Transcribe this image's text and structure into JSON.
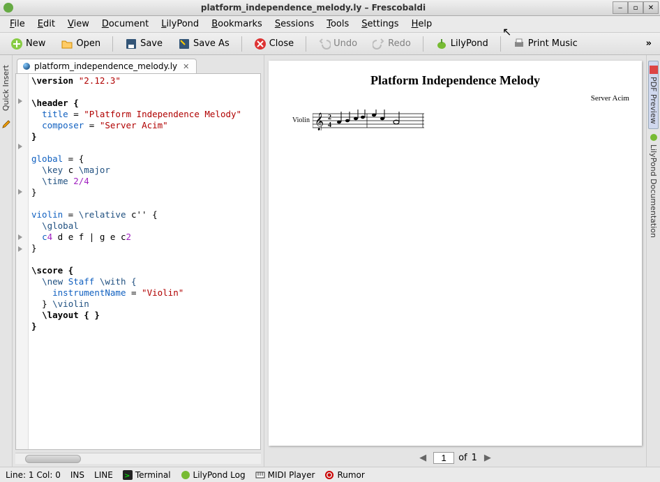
{
  "window": {
    "title": "platform_independence_melody.ly – Frescobaldi"
  },
  "menubar": [
    "File",
    "Edit",
    "View",
    "Document",
    "LilyPond",
    "Bookmarks",
    "Sessions",
    "Tools",
    "Settings",
    "Help"
  ],
  "toolbar": {
    "new": "New",
    "open": "Open",
    "save": "Save",
    "saveas": "Save As",
    "close": "Close",
    "undo": "Undo",
    "redo": "Redo",
    "lilypond": "LilyPond",
    "print": "Print Music"
  },
  "leftdock": {
    "label": "Quick Insert"
  },
  "tab": {
    "name": "platform_independence_melody.ly"
  },
  "code": {
    "l1a": "\\version",
    "l1b": "\"2.12.3\"",
    "l3a": "\\header {",
    "l4a": "title",
    "l4b": " = ",
    "l4c": "\"Platform Independence Melody\"",
    "l5a": "composer",
    "l5b": " = ",
    "l5c": "\"Server Acim\"",
    "l6a": "}",
    "l8a": "global",
    "l8b": " = {",
    "l9a": "\\key",
    "l9b": " c ",
    "l9c": "\\major",
    "l10a": "\\time",
    "l10b": " 2/4",
    "l11a": "}",
    "l13a": "violin",
    "l13b": " = ",
    "l13c": "\\relative",
    "l13d": " c'' {",
    "l14a": "\\global",
    "l15a": "c",
    "l15b": "4",
    "l15c": " d e f | g e c",
    "l15d": "2",
    "l16a": "}",
    "l18a": "\\score {",
    "l19a": "\\new",
    "l19b": " Staff ",
    "l19c": "\\with {",
    "l20a": "instrumentName",
    "l20b": " = ",
    "l20c": "\"Violin\"",
    "l21a": "} ",
    "l21b": "\\violin",
    "l22a": "\\layout { }",
    "l23a": "}"
  },
  "pdf": {
    "title": "Platform Independence Melody",
    "composer": "Server Acim",
    "instrument": "Violin"
  },
  "pager": {
    "current": "1",
    "of": "of",
    "total": "1"
  },
  "rightdock": {
    "preview": "PDF Preview",
    "docs": "LilyPond Documentation"
  },
  "statusbar": {
    "pos": "Line: 1 Col: 0",
    "ins": "INS",
    "mode": "LINE",
    "terminal": "Terminal",
    "log": "LilyPond Log",
    "midi": "MIDI Player",
    "rumor": "Rumor"
  }
}
